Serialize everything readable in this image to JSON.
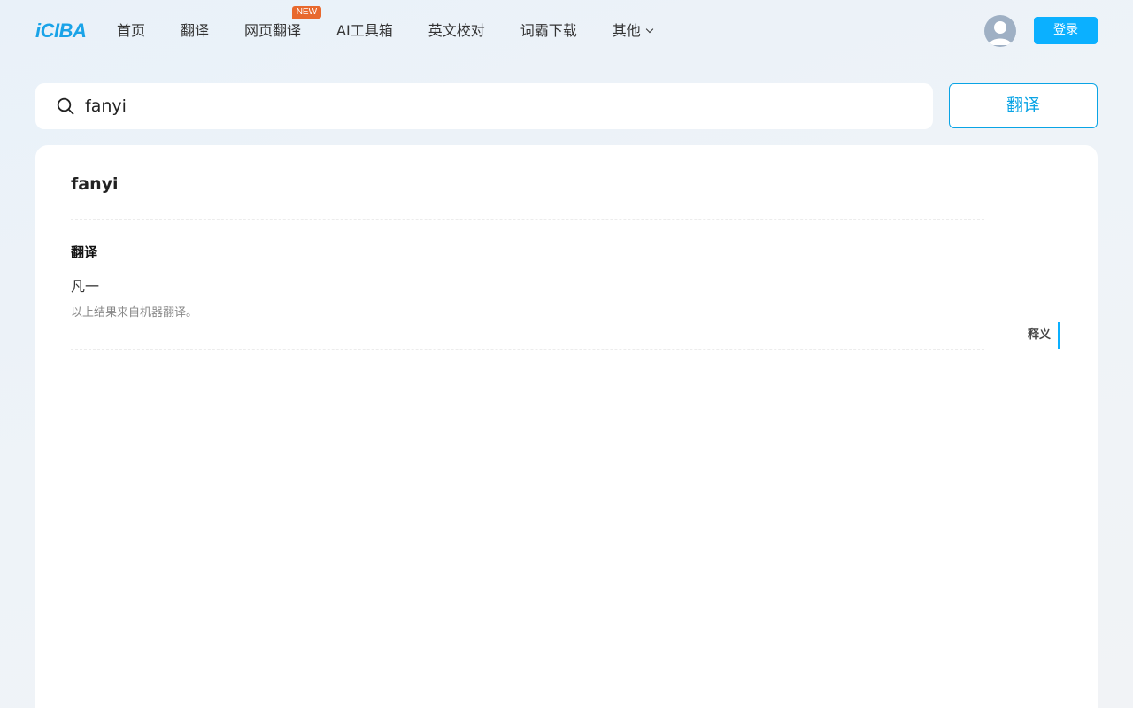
{
  "header": {
    "logo": "iCIBA",
    "nav": [
      {
        "label": "首页"
      },
      {
        "label": "翻译"
      },
      {
        "label": "网页翻译",
        "badge": "NEW"
      },
      {
        "label": "AI工具箱"
      },
      {
        "label": "英文校对"
      },
      {
        "label": "词霸下载"
      },
      {
        "label": "其他"
      }
    ],
    "login_label": "登录"
  },
  "search": {
    "value": "fanyi",
    "button_label": "翻译"
  },
  "result": {
    "word": "fanyi",
    "section_label": "翻译",
    "translation": "凡一",
    "note": "以上结果来自机器翻译。",
    "side_tab": "释义"
  },
  "colors": {
    "accent": "#0bb0ff",
    "badge": "#e8692e",
    "logo": "#1aa3e8"
  },
  "icons": {
    "search": "search-icon",
    "avatar": "user-avatar-icon",
    "dropdown": "chevron-down-icon"
  }
}
